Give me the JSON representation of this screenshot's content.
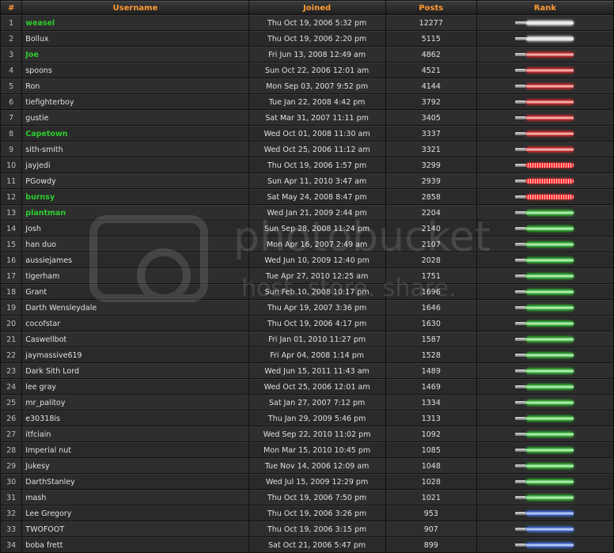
{
  "headers": {
    "num": "#",
    "username": "Username",
    "joined": "Joined",
    "posts": "Posts",
    "rank": "Rank"
  },
  "watermark": {
    "line1": "photobucket",
    "line2": "host. store. share."
  },
  "rows": [
    {
      "n": "1",
      "user": "weasel",
      "green": true,
      "joined": "Thu Oct 19, 2006 5:32 pm",
      "posts": "12277",
      "saber": "white"
    },
    {
      "n": "2",
      "user": "Bollux",
      "green": false,
      "joined": "Thu Oct 19, 2006 2:20 pm",
      "posts": "5115",
      "saber": "white"
    },
    {
      "n": "3",
      "user": "Joe",
      "green": true,
      "joined": "Fri Jun 13, 2008 12:49 am",
      "posts": "4862",
      "saber": "red"
    },
    {
      "n": "4",
      "user": "spoons",
      "green": false,
      "joined": "Sun Oct 22, 2006 12:01 am",
      "posts": "4521",
      "saber": "red"
    },
    {
      "n": "5",
      "user": "Ron",
      "green": false,
      "joined": "Mon Sep 03, 2007 9:52 pm",
      "posts": "4144",
      "saber": "red"
    },
    {
      "n": "6",
      "user": "tiefighterboy",
      "green": false,
      "joined": "Tue Jan 22, 2008 4:42 pm",
      "posts": "3792",
      "saber": "red"
    },
    {
      "n": "7",
      "user": "gustie",
      "green": false,
      "joined": "Sat Mar 31, 2007 11:11 pm",
      "posts": "3405",
      "saber": "red"
    },
    {
      "n": "8",
      "user": "Capetown",
      "green": true,
      "joined": "Wed Oct 01, 2008 11:30 am",
      "posts": "3337",
      "saber": "red"
    },
    {
      "n": "9",
      "user": "sith-smith",
      "green": false,
      "joined": "Wed Oct 25, 2006 11:12 am",
      "posts": "3321",
      "saber": "red"
    },
    {
      "n": "10",
      "user": "jayjedi",
      "green": false,
      "joined": "Thu Oct 19, 2006 1:57 pm",
      "posts": "3299",
      "saber": "red-dash"
    },
    {
      "n": "11",
      "user": "PGowdy",
      "green": false,
      "joined": "Sun Apr 11, 2010 3:47 am",
      "posts": "2939",
      "saber": "red-dash"
    },
    {
      "n": "12",
      "user": "burnsy",
      "green": true,
      "joined": "Sat May 24, 2008 8:47 pm",
      "posts": "2858",
      "saber": "red-dash"
    },
    {
      "n": "13",
      "user": "plantman",
      "green": true,
      "joined": "Wed Jan 21, 2009 2:44 pm",
      "posts": "2204",
      "saber": "green"
    },
    {
      "n": "14",
      "user": "Josh",
      "green": false,
      "joined": "Sun Sep 28, 2008 11:24 pm",
      "posts": "2140",
      "saber": "green"
    },
    {
      "n": "15",
      "user": "han duo",
      "green": false,
      "joined": "Mon Apr 16, 2007 2:49 am",
      "posts": "2107",
      "saber": "green"
    },
    {
      "n": "16",
      "user": "aussiejames",
      "green": false,
      "joined": "Wed Jun 10, 2009 12:40 pm",
      "posts": "2028",
      "saber": "green"
    },
    {
      "n": "17",
      "user": "tigerham",
      "green": false,
      "joined": "Tue Apr 27, 2010 12:25 am",
      "posts": "1751",
      "saber": "green"
    },
    {
      "n": "18",
      "user": "Grant",
      "green": false,
      "joined": "Sun Feb 10, 2008 10:17 pm",
      "posts": "1696",
      "saber": "green"
    },
    {
      "n": "19",
      "user": "Darth Wensleydale",
      "green": false,
      "joined": "Thu Apr 19, 2007 3:36 pm",
      "posts": "1646",
      "saber": "green"
    },
    {
      "n": "20",
      "user": "cocofstar",
      "green": false,
      "joined": "Thu Oct 19, 2006 4:17 pm",
      "posts": "1630",
      "saber": "green"
    },
    {
      "n": "21",
      "user": "Caswellbot",
      "green": false,
      "joined": "Fri Jan 01, 2010 11:27 pm",
      "posts": "1587",
      "saber": "green"
    },
    {
      "n": "22",
      "user": "jaymassive619",
      "green": false,
      "joined": "Fri Apr 04, 2008 1:14 pm",
      "posts": "1528",
      "saber": "green"
    },
    {
      "n": "23",
      "user": "Dark Sith Lord",
      "green": false,
      "joined": "Wed Jun 15, 2011 11:43 am",
      "posts": "1489",
      "saber": "green"
    },
    {
      "n": "24",
      "user": "lee gray",
      "green": false,
      "joined": "Wed Oct 25, 2006 12:01 am",
      "posts": "1469",
      "saber": "green"
    },
    {
      "n": "25",
      "user": "mr_palitoy",
      "green": false,
      "joined": "Sat Jan 27, 2007 7:12 pm",
      "posts": "1334",
      "saber": "green"
    },
    {
      "n": "26",
      "user": "e30318is",
      "green": false,
      "joined": "Thu Jan 29, 2009 5:46 pm",
      "posts": "1313",
      "saber": "green"
    },
    {
      "n": "27",
      "user": "itfciain",
      "green": false,
      "joined": "Wed Sep 22, 2010 11:02 pm",
      "posts": "1092",
      "saber": "green"
    },
    {
      "n": "28",
      "user": "Imperial nut",
      "green": false,
      "joined": "Mon Mar 15, 2010 10:45 pm",
      "posts": "1085",
      "saber": "green"
    },
    {
      "n": "29",
      "user": "Jukesy",
      "green": false,
      "joined": "Tue Nov 14, 2006 12:09 am",
      "posts": "1048",
      "saber": "green"
    },
    {
      "n": "30",
      "user": "DarthStanley",
      "green": false,
      "joined": "Wed Jul 15, 2009 12:29 pm",
      "posts": "1028",
      "saber": "green"
    },
    {
      "n": "31",
      "user": "mash",
      "green": false,
      "joined": "Thu Oct 19, 2006 7:50 pm",
      "posts": "1021",
      "saber": "green"
    },
    {
      "n": "32",
      "user": "Lee Gregory",
      "green": false,
      "joined": "Thu Oct 19, 2006 3:26 pm",
      "posts": "953",
      "saber": "blue"
    },
    {
      "n": "33",
      "user": "TWOFOOT",
      "green": false,
      "joined": "Thu Oct 19, 2006 3:15 pm",
      "posts": "907",
      "saber": "blue"
    },
    {
      "n": "34",
      "user": "boba frett",
      "green": false,
      "joined": "Sat Oct 21, 2006 5:47 pm",
      "posts": "899",
      "saber": "blue"
    }
  ]
}
